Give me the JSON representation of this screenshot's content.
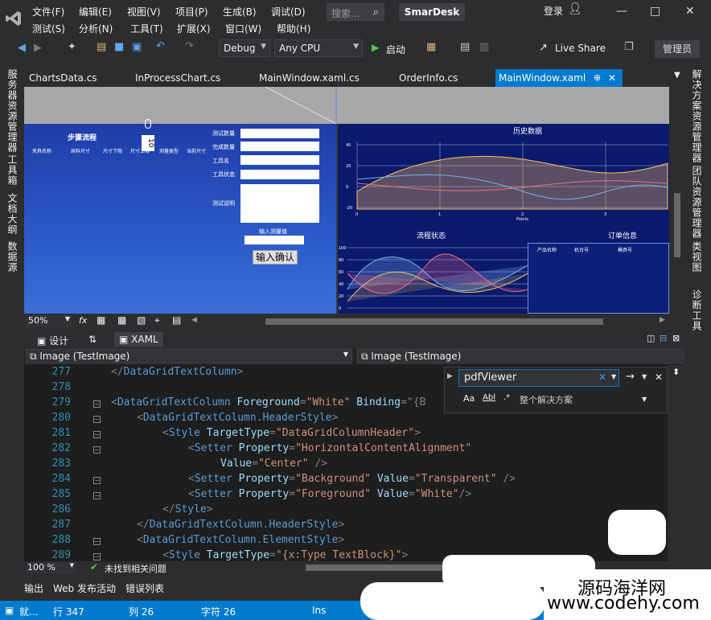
{
  "menu": {
    "row1": [
      "文件(F)",
      "编辑(E)",
      "视图(V)",
      "项目(P)",
      "生成(B)",
      "调试(D)"
    ],
    "row2": [
      "测试(S)",
      "分析(N)",
      "工具(T)",
      "扩展(X)",
      "窗口(W)",
      "帮助(H)"
    ],
    "search_placeholder": "搜索...",
    "app_name": "SmarDesk",
    "login": "登录"
  },
  "toolbar": {
    "config": "Debug",
    "platform": "Any CPU",
    "start": "启动",
    "live_share": "Live Share",
    "admin": "管理员"
  },
  "tabs": [
    "ChartsData.cs",
    "InProcessChart.cs",
    "MainWindow.xaml.cs",
    "OrderInfo.cs",
    "MainWindow.xaml"
  ],
  "left_sidebar": [
    "服务器资源管理器",
    "工具箱",
    "文档大纲",
    "数据源"
  ],
  "right_sidebar": [
    "解决方案资源管理器",
    "团队资源管理器",
    "类视图",
    "诊断工具"
  ],
  "designer": {
    "step_title": "步骤流程",
    "cols": [
      "夹具名称",
      "原料尺寸",
      "尺寸下限",
      "尺寸上限",
      "测量类型",
      "当前尺寸"
    ],
    "spinner": "10",
    "fields": [
      "测试数量",
      "完成数量",
      "工具名",
      "工具状态",
      "测试说明"
    ],
    "measure_label": "输入测量值",
    "confirm": "输入确认",
    "history_title": "历史数据",
    "points_label": "Points",
    "yticks": [
      "40",
      "20",
      "0",
      "-20"
    ],
    "xticks": [
      "0",
      "1",
      "2",
      "3"
    ],
    "process_title": "流程状态",
    "order_title": "订单信息",
    "order_cols": [
      "产品名称",
      "机台号",
      "模具号"
    ],
    "proc_ticks": [
      "100",
      "80",
      "60",
      "40",
      "20",
      "0"
    ]
  },
  "zoom": "50%",
  "split": {
    "design": "设计",
    "xaml": "XAML"
  },
  "nav": {
    "left": "Image (TestImage)",
    "right": "Image (TestImage)"
  },
  "find": {
    "value": "pdfViewer",
    "scope": "整个解决方案",
    "aa": "Aa",
    "ab": "Abl"
  },
  "code_lines": [
    {
      "n": "277",
      "indent": 14,
      "parts": [
        [
          "c-br",
          "</"
        ],
        [
          "c-tag",
          "DataGridTextColumn"
        ],
        [
          "c-br",
          ">"
        ]
      ]
    },
    {
      "n": "278",
      "indent": 0,
      "parts": []
    },
    {
      "n": "279",
      "indent": 14,
      "parts": [
        [
          "c-br",
          "<"
        ],
        [
          "c-tag",
          "DataGridTextColumn"
        ],
        [
          "c-attr",
          " Foreground"
        ],
        [
          "c-br",
          "="
        ],
        [
          "c-str",
          "\"White\""
        ],
        [
          "c-attr",
          " Binding"
        ],
        [
          "c-br",
          "=\"{B"
        ]
      ]
    },
    {
      "n": "280",
      "indent": 18,
      "parts": [
        [
          "c-br",
          "<"
        ],
        [
          "c-tag",
          "DataGridTextColumn.HeaderStyle"
        ],
        [
          "c-br",
          ">"
        ]
      ]
    },
    {
      "n": "281",
      "indent": 22,
      "parts": [
        [
          "c-br",
          "<"
        ],
        [
          "c-tag",
          "Style"
        ],
        [
          "c-attr",
          " TargetType"
        ],
        [
          "c-br",
          "="
        ],
        [
          "c-str",
          "\"DataGridColumnHeader\""
        ],
        [
          "c-br",
          ">"
        ]
      ]
    },
    {
      "n": "282",
      "indent": 26,
      "parts": [
        [
          "c-br",
          "<"
        ],
        [
          "c-tag",
          "Setter"
        ],
        [
          "c-attr",
          " Property"
        ],
        [
          "c-br",
          "="
        ],
        [
          "c-str",
          "\"HorizontalContentAlignment\""
        ]
      ]
    },
    {
      "n": "283",
      "indent": 31,
      "parts": [
        [
          "c-attr",
          "Value"
        ],
        [
          "c-br",
          "="
        ],
        [
          "c-str",
          "\"Center\""
        ],
        [
          "c-br",
          " />"
        ]
      ]
    },
    {
      "n": "284",
      "indent": 26,
      "parts": [
        [
          "c-br",
          "<"
        ],
        [
          "c-tag",
          "Setter"
        ],
        [
          "c-attr",
          " Property"
        ],
        [
          "c-br",
          "="
        ],
        [
          "c-str",
          "\"Background\""
        ],
        [
          "c-attr",
          " Value"
        ],
        [
          "c-br",
          "="
        ],
        [
          "c-str",
          "\"Transparent\""
        ],
        [
          "c-br",
          " />"
        ]
      ]
    },
    {
      "n": "285",
      "indent": 26,
      "parts": [
        [
          "c-br",
          "<"
        ],
        [
          "c-tag",
          "Setter"
        ],
        [
          "c-attr",
          " Property"
        ],
        [
          "c-br",
          "="
        ],
        [
          "c-str",
          "\"Foreground\""
        ],
        [
          "c-attr",
          " Value"
        ],
        [
          "c-br",
          "="
        ],
        [
          "c-str",
          "\"White\""
        ],
        [
          "c-br",
          "/>"
        ]
      ]
    },
    {
      "n": "286",
      "indent": 22,
      "parts": [
        [
          "c-br",
          "</"
        ],
        [
          "c-tag",
          "Style"
        ],
        [
          "c-br",
          ">"
        ]
      ]
    },
    {
      "n": "287",
      "indent": 18,
      "parts": [
        [
          "c-br",
          "</"
        ],
        [
          "c-tag",
          "DataGridTextColumn.HeaderStyle"
        ],
        [
          "c-br",
          ">"
        ]
      ]
    },
    {
      "n": "288",
      "indent": 18,
      "parts": [
        [
          "c-br",
          "<"
        ],
        [
          "c-tag",
          "DataGridTextColumn.ElementStyle"
        ],
        [
          "c-br",
          ">"
        ]
      ]
    },
    {
      "n": "289",
      "indent": 22,
      "parts": [
        [
          "c-br",
          "<"
        ],
        [
          "c-tag",
          "Style"
        ],
        [
          "c-attr",
          " TargetType"
        ],
        [
          "c-br",
          "="
        ],
        [
          "c-str",
          "\"{x:Type TextBlock}\""
        ],
        [
          "c-br",
          ">"
        ]
      ]
    }
  ],
  "editor_status": {
    "zoom": "100 %",
    "issues": "未找到相关问题"
  },
  "output_tabs": [
    "输出",
    "Web 发布活动",
    "错误列表"
  ],
  "statusbar": {
    "ready": "就...",
    "line": "行 347",
    "col": "列 26",
    "char": "字符 26",
    "ins": "Ins"
  },
  "watermark": {
    "line1": "源码海洋网",
    "line2": "www.codehy.com"
  }
}
